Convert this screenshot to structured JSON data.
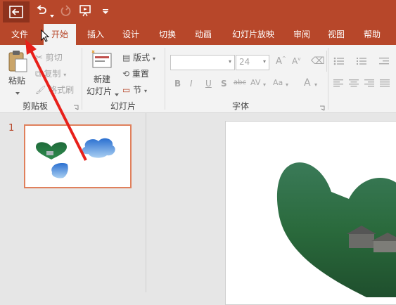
{
  "titlebar": {
    "back_icon": "back-arrow-icon",
    "undo_icon": "undo-icon",
    "redo_icon": "redo-icon",
    "present_icon": "present-from-start-icon",
    "customize_icon": "customize-toolbar-icon"
  },
  "tabs": [
    {
      "label": "文件"
    },
    {
      "label": "开始",
      "active": true
    },
    {
      "label": "插入"
    },
    {
      "label": "设计"
    },
    {
      "label": "切换"
    },
    {
      "label": "动画"
    },
    {
      "label": "幻灯片放映"
    },
    {
      "label": "审阅"
    },
    {
      "label": "视图"
    },
    {
      "label": "帮助"
    }
  ],
  "clipboard": {
    "paste_line1": "粘贴",
    "cut": "剪切",
    "copy": "复制",
    "format_painter": "格式刷",
    "group_label": "剪贴板"
  },
  "slides": {
    "new_slide_line1": "新建",
    "new_slide_line2": "幻灯片",
    "layout": "版式",
    "reset": "重置",
    "section": "节",
    "group_label": "幻灯片"
  },
  "font": {
    "font_name": "",
    "font_size": "24",
    "group_label": "字体",
    "bold": "B",
    "italic": "I",
    "underline": "U",
    "shadow": "S",
    "strike": "abc",
    "spacing": "AV",
    "case": "Aa",
    "color": "A"
  },
  "thumbnail": {
    "number": "1"
  },
  "colors": {
    "accent": "#b7472a",
    "thumb_border": "#e0805c"
  }
}
